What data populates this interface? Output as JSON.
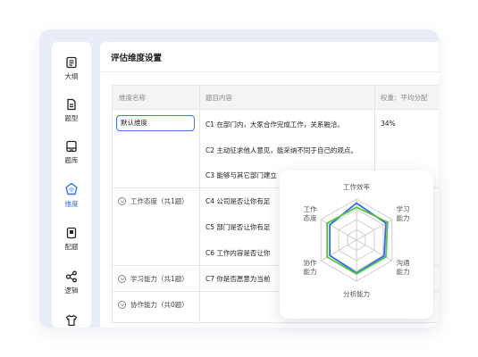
{
  "sidebar": {
    "items": [
      {
        "label": "大纲",
        "icon": "outline-icon",
        "active": false
      },
      {
        "label": "题型",
        "icon": "question-type-icon",
        "active": false
      },
      {
        "label": "题库",
        "icon": "question-bank-icon",
        "active": false
      },
      {
        "label": "维度",
        "icon": "dimension-icon",
        "active": true
      },
      {
        "label": "配题",
        "icon": "assign-questions-icon",
        "active": false
      },
      {
        "label": "逻辑",
        "icon": "logic-icon",
        "active": false
      },
      {
        "label": "",
        "icon": "tshirt-icon",
        "active": false
      }
    ]
  },
  "main": {
    "title": "评估维度设置",
    "table": {
      "headers": [
        "维度名称",
        "题目内容",
        "权重：平均分配"
      ],
      "name_input_value": "默认维度",
      "rows": [
        {
          "group": "",
          "question": "C1 在部门内，大家合作完成工作，关系融洽。",
          "weight": "34%"
        },
        {
          "group": "",
          "question": "C2 主动征求他人意见，能采纳不同于自己的观点。",
          "weight": ""
        },
        {
          "group": "",
          "question": "C3 能够与其它部门建立",
          "weight": ""
        },
        {
          "group": "工作态度（共1题）",
          "question": "C4 公司是否让你有足",
          "weight": ""
        },
        {
          "group": "",
          "question": "C5 部门是否让你有足",
          "weight": ""
        },
        {
          "group": "",
          "question": "C6 工作内容是否让你",
          "weight": ""
        },
        {
          "group": "学习能力（共1题）",
          "question": "C7 你是否愿意为当前",
          "weight": ""
        },
        {
          "group": "协作能力（共0题）",
          "question": "",
          "weight": ""
        }
      ]
    }
  },
  "radar": {
    "axes": [
      "工作效率",
      "学习\n能力",
      "沟通\n能力",
      "分析能力",
      "协作\n能力",
      "工作\n态度"
    ],
    "levels": 4,
    "max": 4,
    "series": [
      {
        "color": "#2d6cf6",
        "values": [
          3.6,
          3.3,
          3.1,
          3.2,
          3.0,
          3.0
        ]
      },
      {
        "color": "#5cc63a",
        "values": [
          3.2,
          3.5,
          3.3,
          3.3,
          3.3,
          3.3
        ]
      }
    ],
    "grid_color": "#c9c9c9",
    "label_color": "#555555"
  }
}
